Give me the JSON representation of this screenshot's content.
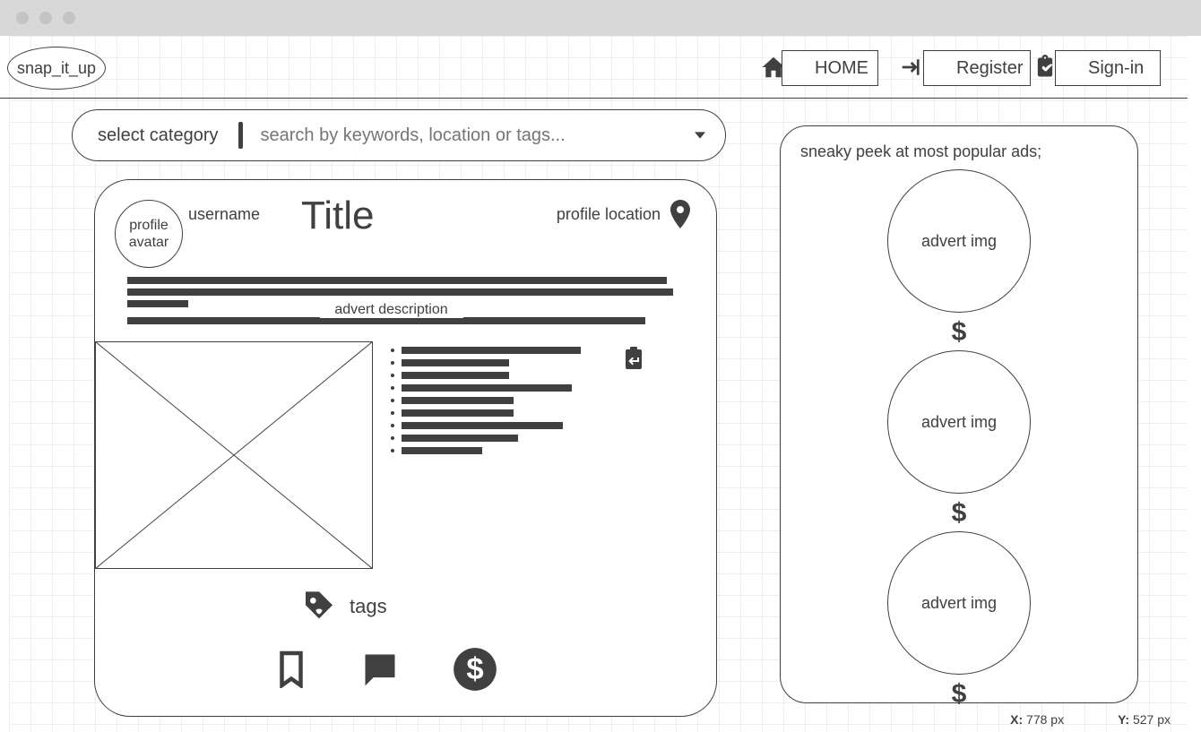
{
  "app": {
    "logo_text": "snap_it_up"
  },
  "nav": {
    "home_label": "HOME",
    "register_label": "Register",
    "signin_label": "Sign-in"
  },
  "search": {
    "category_label": "select category",
    "placeholder": "search by keywords, location or tags..."
  },
  "advert": {
    "avatar_label": "profile avatar",
    "username_label": "username",
    "title": "Title",
    "location_label": "profile location",
    "description_label": "advert description",
    "tags_label": "tags"
  },
  "sidebar": {
    "title": "sneaky peek at most popular ads;",
    "items": [
      {
        "img_label": "advert img",
        "price": "$"
      },
      {
        "img_label": "advert img",
        "price": "$"
      },
      {
        "img_label": "advert img",
        "price": "$"
      }
    ]
  },
  "status": {
    "x_label": "X:",
    "x_value": "778 px",
    "y_label": "Y:",
    "y_value": "527 px"
  }
}
